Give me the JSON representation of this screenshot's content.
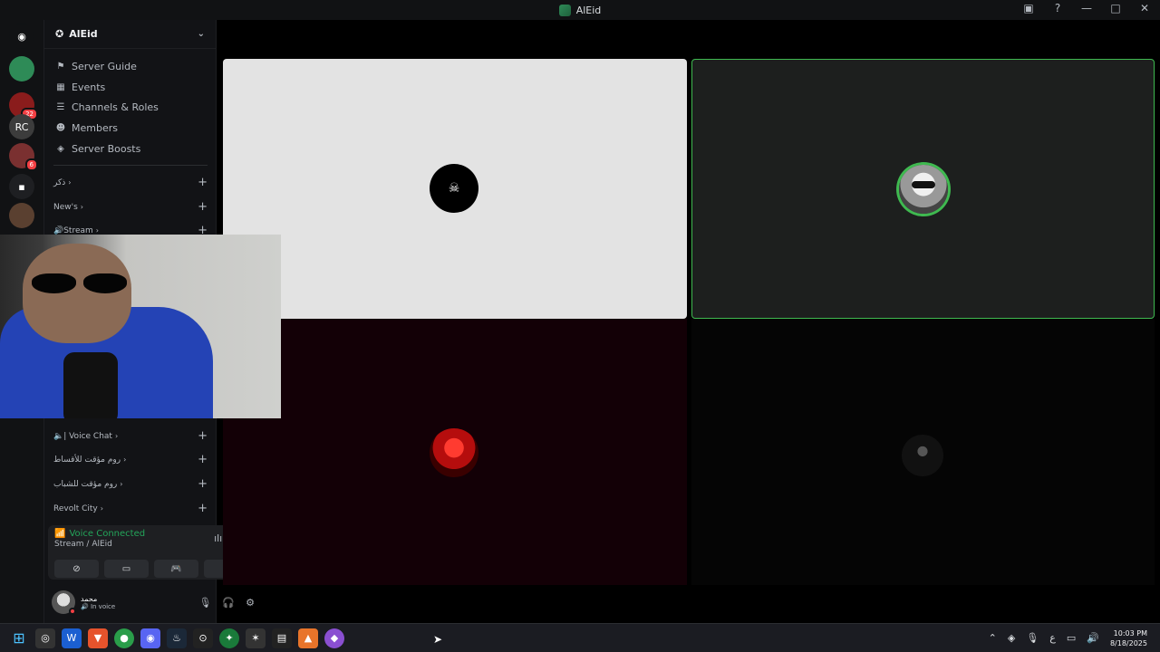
{
  "window": {
    "title": "AlEid"
  },
  "titlebar_icons": [
    "screen-share-icon",
    "help-icon",
    "minimize-icon",
    "maximize-icon",
    "close-icon"
  ],
  "titlebar_glyphs": [
    "▣",
    "?",
    "—",
    "□",
    "✕"
  ],
  "rail": {
    "servers": [
      {
        "name": "discord-home",
        "glyph": "◉",
        "color": "#111214",
        "badge": ""
      },
      {
        "name": "server-alEid",
        "glyph": "",
        "color": "#2e8b57",
        "badge": ""
      },
      {
        "name": "server-red",
        "glyph": "",
        "color": "#8a1c1c",
        "badge": "22"
      },
      {
        "name": "server-rc",
        "glyph": "RC",
        "color": "#3c3c3c",
        "badge": ""
      },
      {
        "name": "server-anime",
        "glyph": "",
        "color": "#7a3030",
        "badge": "6"
      },
      {
        "name": "server-folder",
        "glyph": "▪",
        "color": "#1e1f22",
        "badge": ""
      },
      {
        "name": "server-eagle",
        "glyph": "",
        "color": "#5a4030",
        "badge": ""
      }
    ]
  },
  "sidebar": {
    "server_name": "AlEid",
    "nav": [
      {
        "icon": "server-guide-icon",
        "glyph": "⚑",
        "label": "Server Guide"
      },
      {
        "icon": "events-icon",
        "glyph": "▦",
        "label": "Events"
      },
      {
        "icon": "channels-roles-icon",
        "glyph": "☰",
        "label": "Channels & Roles"
      },
      {
        "icon": "members-icon",
        "glyph": "☻",
        "label": "Members"
      },
      {
        "icon": "server-boosts-icon",
        "glyph": "◈",
        "label": "Server Boosts"
      }
    ],
    "categories_top": [
      {
        "label": "ذكر"
      },
      {
        "label": "New's"
      },
      {
        "label": "🔊Stream"
      }
    ],
    "categories_bottom": [
      {
        "label": "🔈| Voice Chat"
      },
      {
        "label": "روم مؤقت للأقساط"
      },
      {
        "label": "روم مؤقت للشباب"
      },
      {
        "label": "Revolt City"
      }
    ]
  },
  "voice": {
    "status": "Voice Connected",
    "channel": "Stream / AlEid",
    "buttons": [
      "camera-off-icon",
      "screen-share-icon",
      "activity-icon",
      "soundboard-icon"
    ]
  },
  "user": {
    "name": "محمد",
    "status": "In voice"
  },
  "clock": {
    "time": "10:03 PM",
    "date": "8/18/2025"
  },
  "tray": {
    "lang": "ع"
  }
}
